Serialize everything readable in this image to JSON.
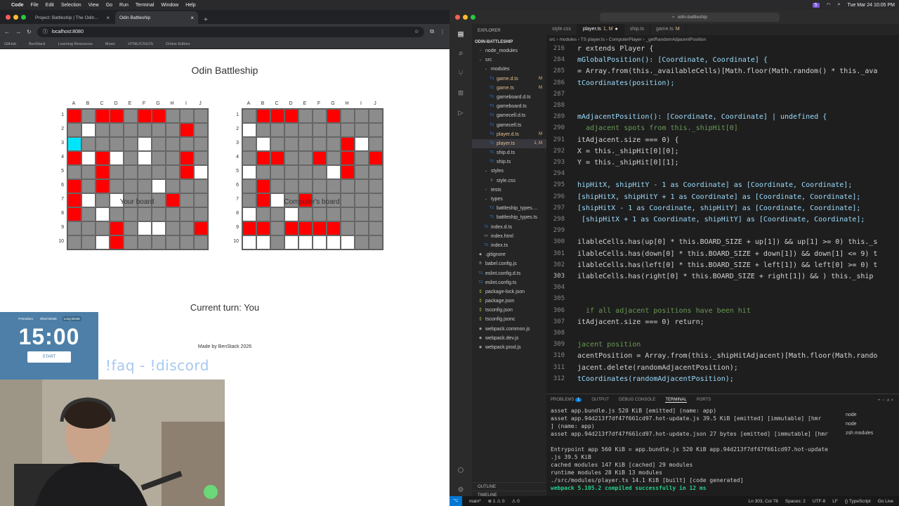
{
  "menubar": {
    "app": "Code",
    "items": [
      "File",
      "Edit",
      "Selection",
      "View",
      "Go",
      "Run",
      "Terminal",
      "Window",
      "Help"
    ],
    "badge": "5",
    "clock": "Tue Mar 24  10:05 PM"
  },
  "browser": {
    "tabs": [
      {
        "label": "Project: Battleship | The Odin..."
      },
      {
        "label": "Odin Battleship"
      }
    ],
    "url": "localhost:8080",
    "bookmarks": [
      "GitHub",
      "BenStack",
      "Learning Resources",
      "Music",
      "HTML/CSS/JS",
      "Online Editors"
    ]
  },
  "page": {
    "title": "Odin Battleship",
    "col_labels": [
      "A",
      "B",
      "C",
      "D",
      "E",
      "F",
      "G",
      "H",
      "I",
      "J"
    ],
    "row_labels": [
      "1",
      "2",
      "3",
      "4",
      "5",
      "6",
      "7",
      "8",
      "9",
      "10"
    ],
    "player_board_label": "Your board",
    "computer_board_label": "Computer's board",
    "player_board": [
      [
        1,
        0,
        1,
        1,
        0,
        1,
        1,
        0,
        0,
        0
      ],
      [
        0,
        2,
        0,
        0,
        0,
        0,
        0,
        0,
        1,
        0
      ],
      [
        3,
        0,
        0,
        0,
        0,
        2,
        0,
        0,
        0,
        0
      ],
      [
        1,
        2,
        1,
        2,
        0,
        2,
        0,
        0,
        1,
        0
      ],
      [
        0,
        0,
        1,
        0,
        0,
        0,
        0,
        0,
        1,
        2
      ],
      [
        1,
        0,
        1,
        0,
        0,
        0,
        2,
        0,
        0,
        0
      ],
      [
        1,
        2,
        0,
        2,
        0,
        0,
        0,
        1,
        0,
        0
      ],
      [
        1,
        0,
        2,
        0,
        0,
        0,
        0,
        0,
        0,
        0
      ],
      [
        0,
        0,
        0,
        1,
        0,
        2,
        2,
        0,
        0,
        1
      ],
      [
        0,
        0,
        2,
        1,
        0,
        0,
        0,
        0,
        0,
        0
      ]
    ],
    "computer_board": [
      [
        0,
        1,
        1,
        1,
        0,
        0,
        1,
        0,
        0,
        0
      ],
      [
        2,
        0,
        0,
        0,
        0,
        0,
        0,
        0,
        0,
        0
      ],
      [
        0,
        2,
        0,
        0,
        0,
        0,
        0,
        1,
        2,
        0
      ],
      [
        0,
        1,
        1,
        0,
        0,
        1,
        0,
        1,
        0,
        1
      ],
      [
        2,
        0,
        0,
        0,
        0,
        0,
        2,
        1,
        0,
        0
      ],
      [
        0,
        1,
        0,
        0,
        0,
        0,
        0,
        0,
        0,
        0
      ],
      [
        0,
        1,
        2,
        0,
        1,
        0,
        0,
        0,
        0,
        0
      ],
      [
        2,
        0,
        0,
        2,
        0,
        0,
        0,
        0,
        0,
        0
      ],
      [
        1,
        1,
        0,
        1,
        1,
        1,
        1,
        0,
        0,
        0
      ],
      [
        2,
        2,
        0,
        2,
        2,
        2,
        2,
        2,
        0,
        0
      ]
    ],
    "turn_text": "Current turn: You",
    "footer": "Made by BenStack 2026"
  },
  "pomodoro": {
    "modes": [
      "Pomodoro",
      "Short Break",
      "Long Break"
    ],
    "time": "15:00",
    "start": "START"
  },
  "overlay_text": "!faq - !discord",
  "vscode": {
    "search": "odin-battleship",
    "explorer_header": "EXPLORER",
    "root": "ODIN-BATTLESHIP",
    "tree": [
      {
        "label": "node_modules",
        "indent": 1,
        "icon": "›",
        "status": ""
      },
      {
        "label": "src",
        "indent": 1,
        "icon": "⌄",
        "status": ""
      },
      {
        "label": "modules",
        "indent": 2,
        "icon": "⌄",
        "status": ""
      },
      {
        "label": "game.d.ts",
        "indent": 3,
        "icon": "TS",
        "status": "M"
      },
      {
        "label": "game.ts",
        "indent": 3,
        "icon": "TS",
        "status": "M"
      },
      {
        "label": "gameboard.d.ts",
        "indent": 3,
        "icon": "TS",
        "status": ""
      },
      {
        "label": "gameboard.ts",
        "indent": 3,
        "icon": "TS",
        "status": ""
      },
      {
        "label": "gamecell.d.ts",
        "indent": 3,
        "icon": "TS",
        "status": ""
      },
      {
        "label": "gamecell.ts",
        "indent": 3,
        "icon": "TS",
        "status": ""
      },
      {
        "label": "player.d.ts",
        "indent": 3,
        "icon": "TS",
        "status": "M"
      },
      {
        "label": "player.ts",
        "indent": 3,
        "icon": "TS",
        "status": "1, M"
      },
      {
        "label": "ship.d.ts",
        "indent": 3,
        "icon": "TS",
        "status": ""
      },
      {
        "label": "ship.ts",
        "indent": 3,
        "icon": "TS",
        "status": ""
      },
      {
        "label": "styles",
        "indent": 2,
        "icon": "⌄",
        "status": ""
      },
      {
        "label": "style.css",
        "indent": 3,
        "icon": "#",
        "status": ""
      },
      {
        "label": "tests",
        "indent": 2,
        "icon": "›",
        "status": ""
      },
      {
        "label": "types",
        "indent": 2,
        "icon": "⌄",
        "status": ""
      },
      {
        "label": "battleship_types....",
        "indent": 3,
        "icon": "TS",
        "status": ""
      },
      {
        "label": "battleship_types.ts",
        "indent": 3,
        "icon": "TS",
        "status": ""
      },
      {
        "label": "index.d.ts",
        "indent": 2,
        "icon": "TS",
        "status": ""
      },
      {
        "label": "index.html",
        "indent": 2,
        "icon": "<>",
        "status": ""
      },
      {
        "label": "index.ts",
        "indent": 2,
        "icon": "TS",
        "status": ""
      },
      {
        "label": ".gitignore",
        "indent": 1,
        "icon": "◆",
        "status": ""
      },
      {
        "label": "babel.config.js",
        "indent": 1,
        "icon": "B",
        "status": ""
      },
      {
        "label": "eslint.config.d.ts",
        "indent": 1,
        "icon": "TS",
        "status": ""
      },
      {
        "label": "eslint.config.ts",
        "indent": 1,
        "icon": "TS",
        "status": ""
      },
      {
        "label": "package-lock.json",
        "indent": 1,
        "icon": "{}",
        "status": ""
      },
      {
        "label": "package.json",
        "indent": 1,
        "icon": "{}",
        "status": ""
      },
      {
        "label": "tsconfig.json",
        "indent": 1,
        "icon": "{}",
        "status": ""
      },
      {
        "label": "tsconfig.jsonc",
        "indent": 1,
        "icon": "{}",
        "status": ""
      },
      {
        "label": "webpack.common.js",
        "indent": 1,
        "icon": "◉",
        "status": ""
      },
      {
        "label": "webpack.dev.js",
        "indent": 1,
        "icon": "◉",
        "status": ""
      },
      {
        "label": "webpack.prod.js",
        "indent": 1,
        "icon": "◉",
        "status": ""
      }
    ],
    "outline": [
      "OUTLINE",
      "TIMELINE"
    ],
    "tabs": [
      {
        "label": "style.css",
        "mod": ""
      },
      {
        "label": "player.ts",
        "mod": "1, M"
      },
      {
        "label": "ship.ts",
        "mod": ""
      },
      {
        "label": "game.ts",
        "mod": "M"
      }
    ],
    "breadcrumb": "src  ›  modules  ›  TS player.ts  ›  ComputerPlayer  ›  _getRandomAdjacentPosition",
    "code_lines": [
      {
        "n": "216",
        "t": "r extends Player {"
      },
      {
        "n": "284",
        "t": "mGlobalPosition(): [Coordinate, Coordinate] {"
      },
      {
        "n": "285",
        "t": "= Array.from(this._availableCells)[Math.floor(Math.random() * this._ava"
      },
      {
        "n": "286",
        "t": "tCoordinates(position);"
      },
      {
        "n": "287",
        "t": ""
      },
      {
        "n": "288",
        "t": ""
      },
      {
        "n": "289",
        "t": "mAdjacentPosition(): [Coordinate, Coordinate] | undefined {"
      },
      {
        "n": "290",
        "t": "  adjacent spots from this._shipHit[0]"
      },
      {
        "n": "291",
        "t": "itAdjacent.size === 0) {"
      },
      {
        "n": "292",
        "t": "X = this._shipHit[0][0];"
      },
      {
        "n": "293",
        "t": "Y = this._shipHit[0][1];"
      },
      {
        "n": "294",
        "t": ""
      },
      {
        "n": "295",
        "t": "hipHitX, shipHitY - 1 as Coordinate] as [Coordinate, Coordinate];"
      },
      {
        "n": "296",
        "t": "[shipHitX, shipHitY + 1 as Coordinate] as [Coordinate, Coordinate];"
      },
      {
        "n": "297",
        "t": "[shipHitX - 1 as Coordinate, shipHitY] as [Coordinate, Coordinate];"
      },
      {
        "n": "298",
        "t": " [shipHitX + 1 as Coordinate, shipHitY] as [Coordinate, Coordinate];"
      },
      {
        "n": "299",
        "t": ""
      },
      {
        "n": "300",
        "t": "ilableCells.has(up[0] * this.BOARD_SIZE + up[1]) && up[1] >= 0) this._s"
      },
      {
        "n": "301",
        "t": "ilableCells.has(down[0] * this.BOARD_SIZE + down[1]) && down[1] <= 9) t"
      },
      {
        "n": "302",
        "t": "ilableCells.has(left[0] * this.BOARD_SIZE + left[1]) && left[0] >= 0) t"
      },
      {
        "n": "303",
        "t": "ilableCells.has(right[0] * this.BOARD_SIZE + right[1]) && ) this._ship"
      },
      {
        "n": "304",
        "t": ""
      },
      {
        "n": "305",
        "t": ""
      },
      {
        "n": "306",
        "t": "  if all adjacent positions have been hit"
      },
      {
        "n": "307",
        "t": "itAdjacent.size === 0) return;"
      },
      {
        "n": "308",
        "t": ""
      },
      {
        "n": "309",
        "t": "jacent position"
      },
      {
        "n": "310",
        "t": "acentPosition = Array.from(this._shipHitAdjacent)[Math.floor(Math.rando"
      },
      {
        "n": "311",
        "t": "jacent.delete(randomAdjacentPosition);"
      },
      {
        "n": "312",
        "t": "tCoordinates(randomAdjacentPosition);"
      }
    ],
    "panel_tabs": [
      "PROBLEMS",
      "OUTPUT",
      "DEBUG CONSOLE",
      "TERMINAL",
      "PORTS"
    ],
    "problems_count": "1",
    "terminal": [
      {
        "t": "    asset app.bundle.js 520 KiB [emitted] (name: app)",
        "c": ""
      },
      {
        "t": "    asset app.94d213f7df47f661cd97.hot-update.js 39.5 KiB [emitted] [immutable] [hmr",
        "c": ""
      },
      {
        "t": "] (name: app)",
        "c": ""
      },
      {
        "t": "asset app.94d213f7df47f661cd97.hot-update.json 27 bytes [emitted] [immutable] [hmr",
        "c": ""
      },
      {
        "t": "",
        "c": ""
      },
      {
        "t": "Entrypoint app 560 KiB = app.bundle.js 520 KiB app.94d213f7df47f661cd97.hot-update",
        "c": ""
      },
      {
        "t": ".js 39.5 KiB",
        "c": ""
      },
      {
        "t": "cached modules 147 KiB [cached] 29 modules",
        "c": ""
      },
      {
        "t": "runtime modules 28 KiB 13 modules",
        "c": ""
      },
      {
        "t": "./src/modules/player.ts 14.1 KiB [built] [code generated]",
        "c": ""
      },
      {
        "t": "webpack 5.105.2 compiled successfully in 12 ms",
        "c": "g"
      }
    ],
    "processes": [
      "node",
      "node",
      "zsh  modules"
    ],
    "status_left": [
      "main*",
      "⊗ 1 ⚠ 0",
      "⚠ 0"
    ],
    "status_right": [
      "Ln 303, Col 78",
      "Spaces: 2",
      "UTF-8",
      "LF",
      "{} TypeScript",
      "Go Live"
    ]
  }
}
